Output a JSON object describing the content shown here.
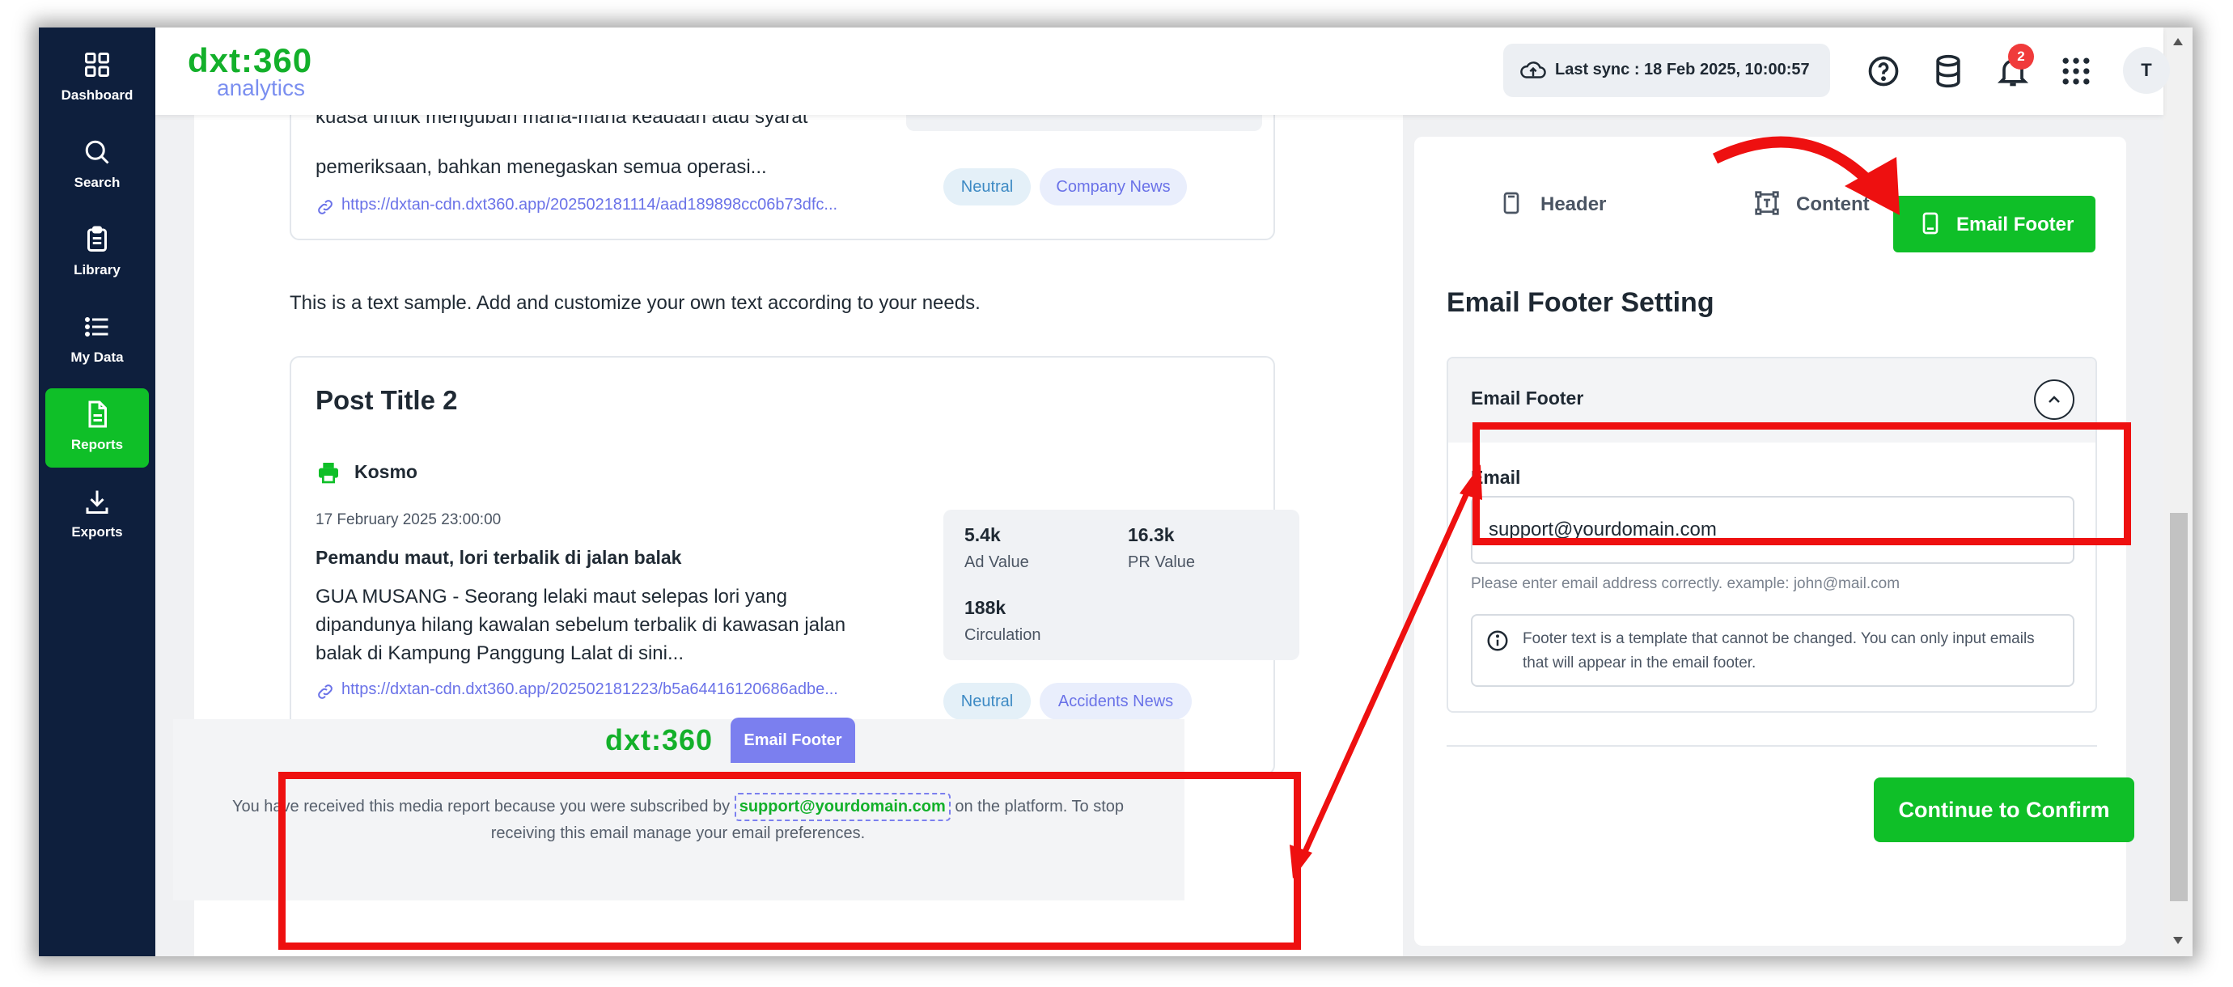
{
  "sidebar": {
    "items": [
      {
        "label": "Dashboard",
        "icon": "grid-icon"
      },
      {
        "label": "Search",
        "icon": "search-icon"
      },
      {
        "label": "Library",
        "icon": "clipboard-icon"
      },
      {
        "label": "My Data",
        "icon": "list-icon"
      },
      {
        "label": "Reports",
        "icon": "document-icon",
        "active": true
      },
      {
        "label": "Exports",
        "icon": "download-icon"
      }
    ]
  },
  "header": {
    "logo_brand": "dxt:360",
    "logo_sub": "analytics",
    "sync_text": "Last sync : 18 Feb 2025, 10:00:57",
    "notification_count": "2",
    "avatar_initial": "T"
  },
  "post1": {
    "excerpt_partial": "kuasa untuk mengubah mana-mana keadaan atau syarat",
    "excerpt_line2": "pemeriksaan, bahkan menegaskan semua operasi...",
    "link": "https://dxtan-cdn.dxt360.app/202502181114/aad189898cc06b73dfc...",
    "tags": [
      "Neutral",
      "Company News"
    ]
  },
  "sample_text": "This is a text sample. Add and customize your own text according to your needs.",
  "post2": {
    "title": "Post Title 2",
    "source": "Kosmo",
    "date": "17 February 2025 23:00:00",
    "headline": "Pemandu maut, lori terbalik di jalan balak",
    "excerpt": "GUA MUSANG - Seorang lelaki maut selepas lori yang dipandunya hilang kawalan sebelum terbalik di kawasan jalan balak di Kampung Panggung Lalat di sini...",
    "link": "https://dxtan-cdn.dxt360.app/202502181223/b5a64416120686adbe...",
    "stats": [
      {
        "value": "5.4k",
        "label": "Ad Value"
      },
      {
        "value": "16.3k",
        "label": "PR Value"
      },
      {
        "value": "188k",
        "label": "Circulation"
      }
    ],
    "tags": [
      "Neutral",
      "Accidents News"
    ]
  },
  "footer_preview": {
    "logo": "dxt:360",
    "tag": "Email Footer",
    "text_before": "You have received this media report because you were subscribed by",
    "email": "support@yourdomain.com",
    "text_after": "on the platform. To stop receiving this email manage your email preferences."
  },
  "panel": {
    "tabs": [
      {
        "label": "Header",
        "icon": "page-icon"
      },
      {
        "label": "Content",
        "icon": "text-frame-icon"
      },
      {
        "label": "Email Footer",
        "icon": "page-icon",
        "active": true
      }
    ],
    "title": "Email Footer Setting",
    "accordion_title": "Email Footer",
    "email_label": "Email",
    "email_value": "support@yourdomain.com",
    "email_help": "Please enter email address correctly. example: john@mail.com",
    "info_text": "Footer text is a template that cannot be changed. You can only input emails that will appear in the email footer.",
    "confirm_label": "Continue to Confirm"
  },
  "colors": {
    "brand_green": "#0fbf28",
    "sidebar_bg": "#0e1f3d",
    "accent_purple": "#7b7fef",
    "annotation_red": "#ee1010"
  }
}
